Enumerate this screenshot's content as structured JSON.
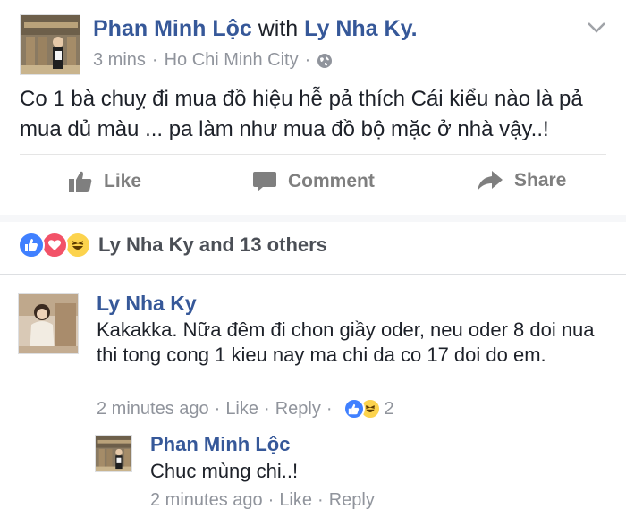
{
  "post": {
    "author": "Phan Minh Lộc",
    "with_word": "with",
    "tagged": "Ly Nha Ky.",
    "time": "3 mins",
    "location": "Ho Chi Minh City",
    "privacy_icon": "globe-icon",
    "text": "Co 1 bà chuỵ đi mua đồ hiệu  hễ pả thích Cái kiểu nào là pả mua dủ màu ... pa làm như mua đồ bộ mặc ở nhà vậy..!"
  },
  "actions": {
    "like": "Like",
    "comment": "Comment",
    "share": "Share"
  },
  "reactions": {
    "summary": "Ly Nha Ky and 13 others",
    "icons": [
      "like-icon",
      "love-icon",
      "haha-icon"
    ],
    "colors": {
      "like": "#4080ff",
      "love": "#f25268",
      "haha": "#fcd34d"
    }
  },
  "comments": [
    {
      "name": "Ly Nha Ky",
      "text": "Kakakka. Nữa đêm đi chon giầy oder, neu oder 8 doi nua thi tong cong 1 kieu nay ma chi da co 17 doi do em.",
      "time": "2 minutes ago",
      "like": "Like",
      "reply": "Reply",
      "reaction_count": "2"
    },
    {
      "name": "Phan Minh Lộc",
      "text": "Chuc mùng chi..!",
      "time": "2 minutes ago",
      "like": "Like",
      "reply": "Reply"
    }
  ],
  "colors": {
    "link_blue": "#365899",
    "meta_gray": "#90949c",
    "action_gray": "#7f7f7f"
  }
}
